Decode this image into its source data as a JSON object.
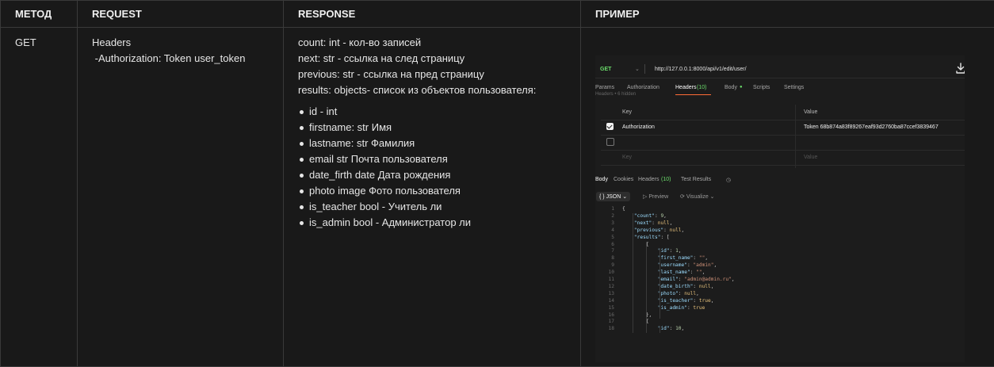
{
  "table": {
    "headers": [
      "МЕТОД",
      "REQUEST",
      "RESPONSE",
      "ПРИМЕР"
    ],
    "method": "GET",
    "request": {
      "line1": "Headers",
      "line2": " -Authorization: Token user_token"
    },
    "response": {
      "lines": [
        "count: int - кол-во записей",
        "next: str - ссылка на след страницу",
        "previous: str - ссылка на пред страницу",
        "results: objects- список из объектов пользователя:"
      ],
      "fields": [
        "id - int",
        "firstname: str Имя",
        "lastname: str Фамилия",
        "email str Почта пользователя",
        "date_firth date Дата рождения",
        "photo image Фото пользователя",
        "is_teacher bool - Учитель ли",
        "is_admin bool - Администратор ли"
      ]
    }
  },
  "example": {
    "method": "GET",
    "url": "http://127.0.0.1:8000/api/v1/edit/user/",
    "request_tabs": [
      "Params",
      "Authorization",
      "Headers",
      "(10)",
      "Body",
      "Scripts",
      "Settings"
    ],
    "ghost_text": "Headers  •  6 hidden",
    "headers_table": {
      "col_key": "Key",
      "col_value": "Value",
      "row_key": "Authorization",
      "row_value": "Token 68b874a83f89267eaf93d2760ba87ccef3839467",
      "placeholder_key": "Key",
      "placeholder_value": "Value"
    },
    "response_tabs": [
      "Body",
      "Cookies",
      "Headers",
      "(10)",
      "Test Results"
    ],
    "format": "JSON",
    "preview": "Preview",
    "visualize": "Visualize",
    "code_lines": [
      {
        "n": "1",
        "t": "{"
      },
      {
        "n": "2",
        "t": "    \"count\": 9,"
      },
      {
        "n": "3",
        "t": "    \"next\": null,"
      },
      {
        "n": "4",
        "t": "    \"previous\": null,"
      },
      {
        "n": "5",
        "t": "    \"results\": ["
      },
      {
        "n": "6",
        "t": "        {"
      },
      {
        "n": "7",
        "t": "            \"id\": 1,"
      },
      {
        "n": "8",
        "t": "            \"first_name\": \"\","
      },
      {
        "n": "9",
        "t": "            \"username\": \"admin\","
      },
      {
        "n": "10",
        "t": "            \"last_name\": \"\","
      },
      {
        "n": "11",
        "t": "            \"email\": \"admin@admin.ru\","
      },
      {
        "n": "12",
        "t": "            \"date_birth\": null,"
      },
      {
        "n": "13",
        "t": "            \"photo\": null,"
      },
      {
        "n": "14",
        "t": "            \"is_teacher\": true,"
      },
      {
        "n": "15",
        "t": "            \"is_admin\": true"
      },
      {
        "n": "16",
        "t": "        },"
      },
      {
        "n": "17",
        "t": "        {"
      },
      {
        "n": "18",
        "t": "            \"id\": 10,"
      }
    ]
  },
  "icons": {
    "download": "download-icon",
    "history": "history-icon"
  },
  "colors": {
    "background": "#191919",
    "accent_orange": "#ff6c37",
    "method_green": "#6bdd6b"
  }
}
